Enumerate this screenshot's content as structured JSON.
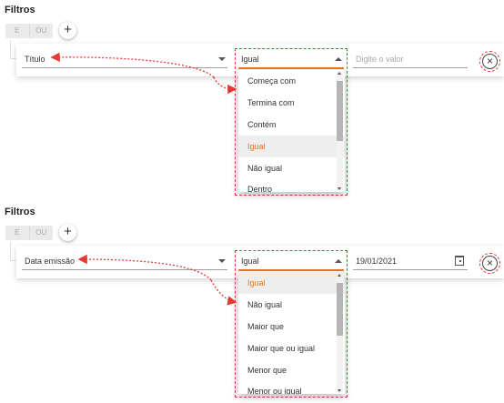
{
  "panels": [
    {
      "title": "Filtros",
      "toggle": {
        "and": "E",
        "or": "OU"
      },
      "add": "+",
      "field": "Título",
      "operator": "Igual",
      "value_placeholder": "Digite o valor",
      "value": "",
      "close": "×",
      "options": [
        "Começa com",
        "Termina com",
        "Contém",
        "Igual",
        "Não igual",
        "Dentro"
      ],
      "selected": "Igual"
    },
    {
      "title": "Filtros",
      "toggle": {
        "and": "E",
        "or": "OU"
      },
      "add": "+",
      "field": "Data emissão",
      "operator": "Igual",
      "value_placeholder": "",
      "value": "19/01/2021",
      "close": "×",
      "options": [
        "Igual",
        "Não igual",
        "Maior que",
        "Maior que ou igual",
        "Menor que",
        "Menor ou igual"
      ],
      "selected": "Igual"
    }
  ],
  "colors": {
    "accent": "#e87722",
    "annotation": "#e53935"
  }
}
